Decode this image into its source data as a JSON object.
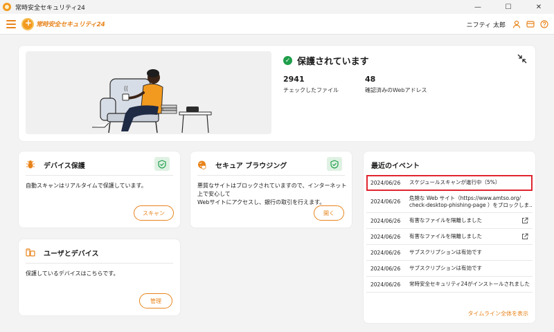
{
  "window": {
    "title": "常時安全セキュリティ24",
    "controls": [
      "—",
      "☐",
      "✕"
    ]
  },
  "header": {
    "logo_text": "常時安全セキュリティ24",
    "user_name": "ニフティ 太郎"
  },
  "hero": {
    "status": "保護されています",
    "stats": [
      {
        "value": "2941",
        "label": "チェックしたファイル"
      },
      {
        "value": "48",
        "label": "確認済みのWebアドレス"
      }
    ]
  },
  "device_card": {
    "title": "デバイス保護",
    "body": "自動スキャンはリアルタイムで保護しています。",
    "button": "スキャン"
  },
  "secure_card": {
    "title": "セキュア ブラウジング",
    "body_line1": "悪質なサイトはブロックされていますので、インターネット上で安心して",
    "body_line2": "Webサイトにアクセスし、銀行の取引を行えます。",
    "button": "開く"
  },
  "users_card": {
    "title": "ユーザとデバイス",
    "body": "保護しているデバイスはこちらです。",
    "button": "管理"
  },
  "events": {
    "title": "最近のイベント",
    "items": [
      {
        "date": "2024/06/26",
        "text": "スケジュールスキャンが進行中（5%）",
        "text2": ""
      },
      {
        "date": "2024/06/26",
        "text": "危険な Web サイト（https://www.amtso.org/",
        "text2": "check-desktop-phishing-page ）をブロックしま..."
      },
      {
        "date": "2024/06/26",
        "text": "有害なファイルを隔離しました",
        "text2": ""
      },
      {
        "date": "2024/06/26",
        "text": "有害なファイルを隔離しました",
        "text2": ""
      },
      {
        "date": "2024/06/26",
        "text": "サブスクリプションは有効です",
        "text2": ""
      },
      {
        "date": "2024/06/26",
        "text": "サブスクリプションは有効です",
        "text2": ""
      },
      {
        "date": "2024/06/26",
        "text": "常時安全セキュリティ24がインストールされました",
        "text2": ""
      }
    ],
    "view_all": "タイムライン全体を表示"
  },
  "colors": {
    "accent": "#e8831a",
    "ok": "#1e9e4a",
    "highlight": "#e0242e"
  }
}
